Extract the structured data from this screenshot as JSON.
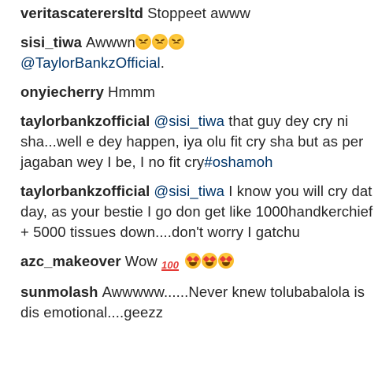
{
  "comments": [
    {
      "username": "veritascaterersltd",
      "text": "Stoppeet awww"
    },
    {
      "username": "sisi_tiwa",
      "text": "Awwwn",
      "emojis": [
        "sad-face-emoji",
        "sad-face-emoji",
        "sad-face-emoji"
      ],
      "mention": "@TaylorBankzOfficial",
      "text_after": "."
    },
    {
      "username": "onyiecherry",
      "text": "Hmmm"
    },
    {
      "username": "taylorbankzofficial",
      "mention": "@sisi_tiwa",
      "text": "that guy dey cry ni sha...well e dey happen, iya olu fit cry sha but as per jagaban wey I be, I no fit cry",
      "hashtag": "#oshamoh"
    },
    {
      "username": "taylorbankzofficial",
      "mention": "@sisi_tiwa",
      "text": "I know you will cry dat day, as your bestie I go don get like 1000handkerchief + 5000 tissues down....don't worry I gatchu"
    },
    {
      "username": "azc_makeover",
      "text": "Wow",
      "emojis": [
        "hundred-points-emoji",
        "heart-eyes-emoji",
        "heart-eyes-emoji",
        "heart-eyes-emoji"
      ],
      "hundred_label": "100"
    },
    {
      "username": "sunmolash",
      "text": "Awwwww......Never knew tolubabalola is dis emotional....geezz"
    }
  ]
}
